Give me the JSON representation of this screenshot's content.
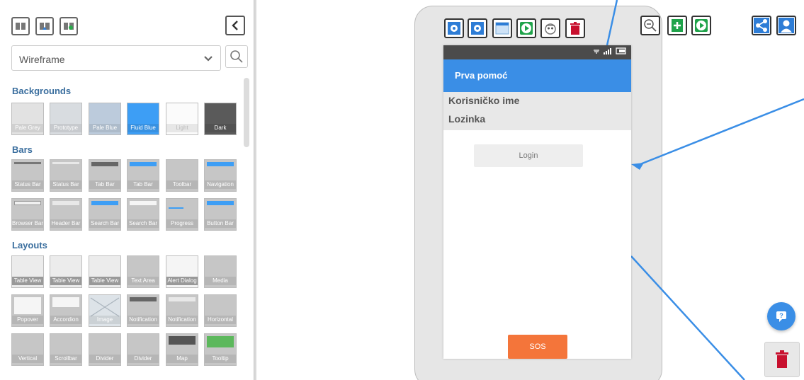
{
  "sidebar": {
    "theme_select": {
      "value": "Wireframe"
    },
    "sections": {
      "backgrounds": {
        "title": "Backgrounds",
        "items": [
          "Pale Grey",
          "Prototype",
          "Pale Blue",
          "Fluid Blue",
          "Light",
          "Dark"
        ]
      },
      "bars": {
        "title": "Bars",
        "row1": [
          "Status Bar",
          "Status Bar",
          "Tab Bar",
          "Tab Bar",
          "Toolbar",
          "Navigation"
        ],
        "row2": [
          "Browser Bar",
          "Header Bar",
          "Search Bar",
          "Search Bar",
          "Progress",
          "Button Bar"
        ]
      },
      "layouts": {
        "title": "Layouts",
        "row1": [
          "Table View",
          "Table View",
          "Table View",
          "Text Area",
          "Alert Dialog",
          "Media"
        ],
        "row2": [
          "Popover",
          "Accordion",
          "Image",
          "Notification",
          "Notification",
          "Horizontal"
        ],
        "row3": [
          "Vertical",
          "Scrollbar",
          "Divider",
          "Divider",
          "Map",
          "Tooltip"
        ]
      }
    }
  },
  "phone": {
    "nav_title": "Prva pomoć",
    "rows": [
      "Korisničko ime",
      "Lozinka"
    ],
    "login_label": "Login",
    "sos_label": "SOS"
  },
  "colors": {
    "accent_blue": "#3a8ee6",
    "sos_orange": "#f4753a",
    "green": "#1fa34a",
    "red": "#c8102e"
  },
  "icons": {
    "toolbar_left": [
      "book-icon",
      "import-icon",
      "refresh-icon"
    ],
    "phone_toolbar": [
      "settings-gear-icon",
      "view-gear-icon",
      "window-icon",
      "play-icon",
      "preview-icon",
      "trash-icon"
    ],
    "right_toolbar": [
      "zoom-out-icon",
      "add-screen-icon",
      "play-icon",
      "share-icon",
      "user-icon"
    ]
  }
}
